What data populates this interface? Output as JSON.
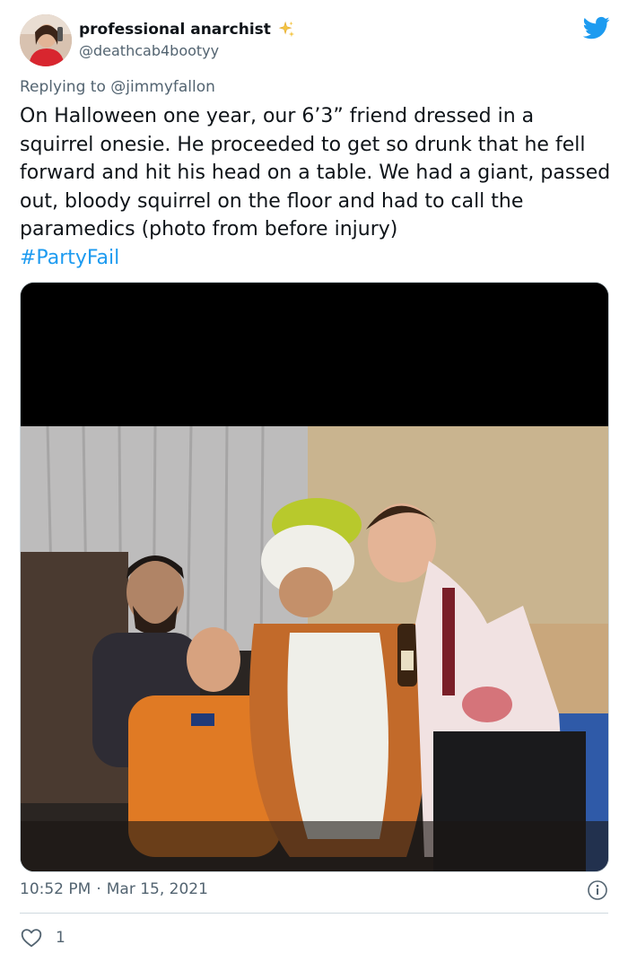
{
  "author": {
    "display_name": "professional anarchist",
    "handle": "@deathcab4bootyy",
    "avatar_icon": "profile-photo",
    "badge_icon": "sparkles"
  },
  "reply_context": {
    "prefix": "Replying to ",
    "mention": "@jimmyfallon"
  },
  "tweet": {
    "text": "On Halloween one year, our 6’3” friend dressed in a squirrel onesie. He proceeded to get so drunk that he fell forward and hit his head on a table. We had a giant, passed out, bloody squirrel on the floor and had to call the paramedics (photo from before injury)",
    "hashtag": "#PartyFail",
    "media_icon": "group-halloween-photo"
  },
  "meta": {
    "time": "10:52 PM",
    "separator": "·",
    "date": "Mar 15, 2021"
  },
  "actions": {
    "likes": "1"
  },
  "colors": {
    "link": "#1d9bf0",
    "secondary_text": "#536471",
    "twitter_blue": "#1d9bf0"
  }
}
